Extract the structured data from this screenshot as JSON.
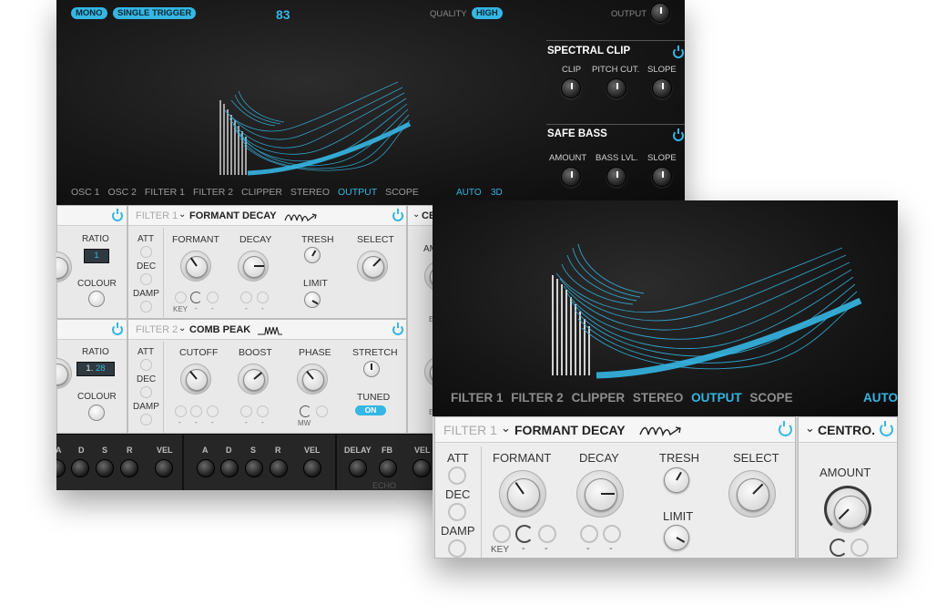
{
  "back": {
    "header": {
      "mode_pills": [
        "MONO",
        "SINGLE TRIGGER"
      ],
      "value": "83",
      "quality_label": "QUALITY",
      "quality_value": "HIGH",
      "output_label": "OUTPUT"
    },
    "spectral_clip": {
      "title": "SPECTRAL CLIP",
      "labels": [
        "CLIP",
        "PITCH CUT.",
        "SLOPE"
      ]
    },
    "safe_bass": {
      "title": "SAFE BASS",
      "labels": [
        "AMOUNT",
        "BASS LVL.",
        "SLOPE"
      ]
    },
    "tabs": [
      "OSC 1",
      "OSC 2",
      "FILTER 1",
      "FILTER 2",
      "CLIPPER",
      "STEREO",
      "OUTPUT",
      "SCOPE"
    ],
    "active_tab": "OUTPUT",
    "auto": "AUTO",
    "three_d": "3D",
    "left_top": {
      "ratio_label": "RATIO",
      "ratio_value": "1",
      "colour_label": "COLOUR"
    },
    "left_bottom": {
      "ratio_label": "RATIO",
      "ratio_value": [
        "1.",
        "28"
      ],
      "colour_label": "COLOUR"
    },
    "filter1": {
      "tag": "FILTER 1",
      "name": "FORMANT DECAY",
      "env": [
        "ATT",
        "DEC",
        "DAMP"
      ],
      "knobs": [
        "FORMANT",
        "DECAY",
        "TRESH",
        "SELECT",
        "LIMIT"
      ],
      "key": "KEY",
      "dashes": [
        "-",
        "-",
        "-",
        "-"
      ]
    },
    "filter2": {
      "tag": "FILTER 2",
      "name": "COMB PEAK",
      "env": [
        "ATT",
        "DEC",
        "DAMP"
      ],
      "knobs": [
        "CUTOFF",
        "BOOST",
        "PHASE",
        "STRETCH",
        "TUNED"
      ],
      "tuned_value": "ON",
      "mw": "MW",
      "dashes": [
        "-",
        "-",
        "-",
        "-",
        "-"
      ]
    },
    "right_partial": {
      "title": "CE",
      "label": "AM",
      "e1": "E",
      "e2": "E"
    },
    "envelope": {
      "sec1": [
        "A",
        "D",
        "S",
        "R",
        "VEL"
      ],
      "sec2": [
        "A",
        "D",
        "S",
        "R",
        "VEL"
      ],
      "sec3": [
        "DELAY",
        "FB",
        "VEL"
      ],
      "echo": "ECHO"
    }
  },
  "front": {
    "tabs": [
      "FILTER 1",
      "FILTER 2",
      "CLIPPER",
      "STEREO",
      "OUTPUT",
      "SCOPE"
    ],
    "active_tab": "OUTPUT",
    "auto": "AUTO",
    "filter": {
      "tag": "FILTER 1",
      "name": "FORMANT DECAY",
      "env": [
        "ATT",
        "DEC",
        "DAMP"
      ],
      "knobs": [
        "FORMANT",
        "DECAY",
        "TRESH",
        "SELECT",
        "LIMIT"
      ],
      "key": "KEY",
      "dashes": [
        "-",
        "-",
        "-",
        "-"
      ]
    },
    "centro": {
      "name": "CENTRO.",
      "amount": "AMOUNT"
    }
  },
  "colors": {
    "accent": "#35b6e3",
    "panel": "#ededed",
    "dark": "#141414"
  },
  "icons": [
    "power-icon",
    "chevron-down-icon",
    "waveform-icon"
  ]
}
